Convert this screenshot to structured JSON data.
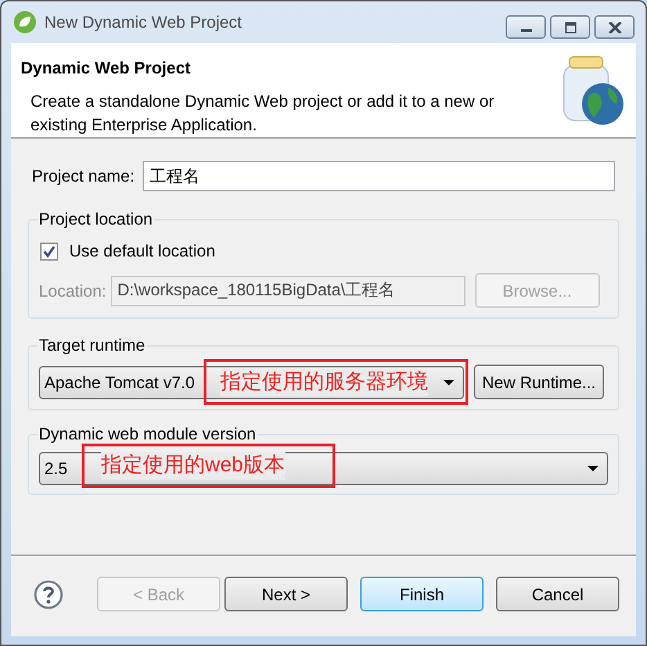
{
  "window": {
    "title": "New Dynamic Web Project"
  },
  "header": {
    "title": "Dynamic Web Project",
    "description": "Create a standalone Dynamic Web project or add it to a new or existing Enterprise Application."
  },
  "project_name": {
    "label": "Project name:",
    "value": "工程名"
  },
  "project_location": {
    "legend": "Project location",
    "use_default": {
      "label": "Use default location",
      "checked": true
    },
    "location": {
      "label": "Location:",
      "value": "D:\\workspace_180115BigData\\工程名",
      "disabled": true
    },
    "browse": {
      "label": "Browse...",
      "disabled": true
    }
  },
  "target_runtime": {
    "legend": "Target runtime",
    "value": "Apache Tomcat v7.0",
    "button": "New Runtime..."
  },
  "module_version": {
    "legend": "Dynamic web module version",
    "value": "2.5"
  },
  "annotations": [
    {
      "text": "指定使用的服务器环境"
    },
    {
      "text": "指定使用的web版本"
    }
  ],
  "buttons": [
    {
      "label": "< Back",
      "disabled": true,
      "default": false
    },
    {
      "label": "Next >",
      "disabled": false,
      "default": false
    },
    {
      "label": "Finish",
      "disabled": false,
      "default": true
    },
    {
      "label": "Cancel",
      "disabled": false,
      "default": false
    }
  ]
}
